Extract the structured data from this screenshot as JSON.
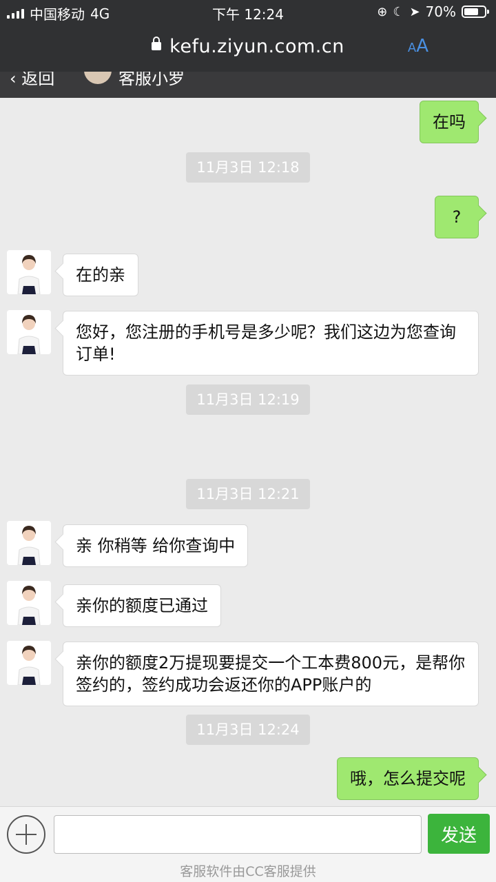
{
  "status_bar": {
    "carrier": "中国移动",
    "network": "4G",
    "time": "下午 12:24",
    "battery": "70%",
    "battery_level": 0.7
  },
  "url_bar": {
    "url": "kefu.ziyun.com.cn",
    "text_size_button": "AA",
    "text_size_small": "A",
    "text_size_large": "A"
  },
  "chat_header": {
    "back_label": "返回",
    "agent_name": "客服小罗"
  },
  "messages": [
    {
      "type": "out",
      "text": "在吗"
    },
    {
      "type": "time",
      "text": "11月3日 12:18"
    },
    {
      "type": "out",
      "text": "?"
    },
    {
      "type": "in",
      "text": "在的亲"
    },
    {
      "type": "in",
      "text": "您好，您注册的手机号是多少呢？我们这边为您查询订单!"
    },
    {
      "type": "time",
      "text": "11月3日 12:19"
    },
    {
      "type": "time",
      "text": "11月3日 12:21"
    },
    {
      "type": "in",
      "text": "亲 你稍等 给你查询中"
    },
    {
      "type": "in",
      "text": "亲你的额度已通过"
    },
    {
      "type": "in",
      "text": "亲你的额度2万提现要提交一个工本费800元，是帮你签约的，签约成功会返还你的APP账户的"
    },
    {
      "type": "time",
      "text": "11月3日 12:24"
    },
    {
      "type": "out",
      "text": "哦，怎么提交呢"
    }
  ],
  "input_bar": {
    "placeholder": "",
    "send_label": "发送"
  },
  "footer": "客服软件由CC客服提供",
  "colors": {
    "outgoing_bubble": "#9fe870",
    "send_button": "#3cb43c",
    "link_accent": "#4a90e2"
  }
}
